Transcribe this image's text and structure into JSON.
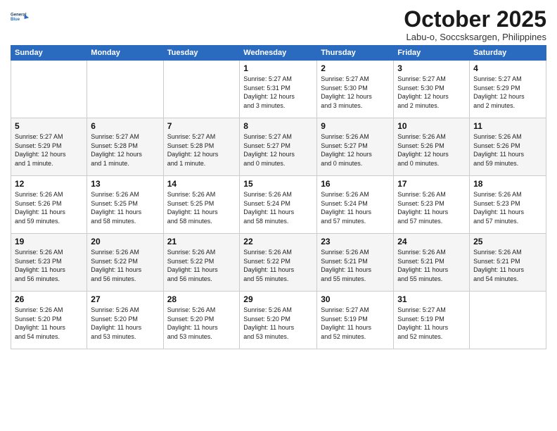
{
  "logo": {
    "line1": "General",
    "line2": "Blue"
  },
  "title": "October 2025",
  "subtitle": "Labu-o, Soccsksargen, Philippines",
  "days_header": [
    "Sunday",
    "Monday",
    "Tuesday",
    "Wednesday",
    "Thursday",
    "Friday",
    "Saturday"
  ],
  "weeks": [
    [
      {
        "day": "",
        "info": ""
      },
      {
        "day": "",
        "info": ""
      },
      {
        "day": "",
        "info": ""
      },
      {
        "day": "1",
        "info": "Sunrise: 5:27 AM\nSunset: 5:31 PM\nDaylight: 12 hours\nand 3 minutes."
      },
      {
        "day": "2",
        "info": "Sunrise: 5:27 AM\nSunset: 5:30 PM\nDaylight: 12 hours\nand 3 minutes."
      },
      {
        "day": "3",
        "info": "Sunrise: 5:27 AM\nSunset: 5:30 PM\nDaylight: 12 hours\nand 2 minutes."
      },
      {
        "day": "4",
        "info": "Sunrise: 5:27 AM\nSunset: 5:29 PM\nDaylight: 12 hours\nand 2 minutes."
      }
    ],
    [
      {
        "day": "5",
        "info": "Sunrise: 5:27 AM\nSunset: 5:29 PM\nDaylight: 12 hours\nand 1 minute."
      },
      {
        "day": "6",
        "info": "Sunrise: 5:27 AM\nSunset: 5:28 PM\nDaylight: 12 hours\nand 1 minute."
      },
      {
        "day": "7",
        "info": "Sunrise: 5:27 AM\nSunset: 5:28 PM\nDaylight: 12 hours\nand 1 minute."
      },
      {
        "day": "8",
        "info": "Sunrise: 5:27 AM\nSunset: 5:27 PM\nDaylight: 12 hours\nand 0 minutes."
      },
      {
        "day": "9",
        "info": "Sunrise: 5:26 AM\nSunset: 5:27 PM\nDaylight: 12 hours\nand 0 minutes."
      },
      {
        "day": "10",
        "info": "Sunrise: 5:26 AM\nSunset: 5:26 PM\nDaylight: 12 hours\nand 0 minutes."
      },
      {
        "day": "11",
        "info": "Sunrise: 5:26 AM\nSunset: 5:26 PM\nDaylight: 11 hours\nand 59 minutes."
      }
    ],
    [
      {
        "day": "12",
        "info": "Sunrise: 5:26 AM\nSunset: 5:26 PM\nDaylight: 11 hours\nand 59 minutes."
      },
      {
        "day": "13",
        "info": "Sunrise: 5:26 AM\nSunset: 5:25 PM\nDaylight: 11 hours\nand 58 minutes."
      },
      {
        "day": "14",
        "info": "Sunrise: 5:26 AM\nSunset: 5:25 PM\nDaylight: 11 hours\nand 58 minutes."
      },
      {
        "day": "15",
        "info": "Sunrise: 5:26 AM\nSunset: 5:24 PM\nDaylight: 11 hours\nand 58 minutes."
      },
      {
        "day": "16",
        "info": "Sunrise: 5:26 AM\nSunset: 5:24 PM\nDaylight: 11 hours\nand 57 minutes."
      },
      {
        "day": "17",
        "info": "Sunrise: 5:26 AM\nSunset: 5:23 PM\nDaylight: 11 hours\nand 57 minutes."
      },
      {
        "day": "18",
        "info": "Sunrise: 5:26 AM\nSunset: 5:23 PM\nDaylight: 11 hours\nand 57 minutes."
      }
    ],
    [
      {
        "day": "19",
        "info": "Sunrise: 5:26 AM\nSunset: 5:23 PM\nDaylight: 11 hours\nand 56 minutes."
      },
      {
        "day": "20",
        "info": "Sunrise: 5:26 AM\nSunset: 5:22 PM\nDaylight: 11 hours\nand 56 minutes."
      },
      {
        "day": "21",
        "info": "Sunrise: 5:26 AM\nSunset: 5:22 PM\nDaylight: 11 hours\nand 56 minutes."
      },
      {
        "day": "22",
        "info": "Sunrise: 5:26 AM\nSunset: 5:22 PM\nDaylight: 11 hours\nand 55 minutes."
      },
      {
        "day": "23",
        "info": "Sunrise: 5:26 AM\nSunset: 5:21 PM\nDaylight: 11 hours\nand 55 minutes."
      },
      {
        "day": "24",
        "info": "Sunrise: 5:26 AM\nSunset: 5:21 PM\nDaylight: 11 hours\nand 55 minutes."
      },
      {
        "day": "25",
        "info": "Sunrise: 5:26 AM\nSunset: 5:21 PM\nDaylight: 11 hours\nand 54 minutes."
      }
    ],
    [
      {
        "day": "26",
        "info": "Sunrise: 5:26 AM\nSunset: 5:20 PM\nDaylight: 11 hours\nand 54 minutes."
      },
      {
        "day": "27",
        "info": "Sunrise: 5:26 AM\nSunset: 5:20 PM\nDaylight: 11 hours\nand 53 minutes."
      },
      {
        "day": "28",
        "info": "Sunrise: 5:26 AM\nSunset: 5:20 PM\nDaylight: 11 hours\nand 53 minutes."
      },
      {
        "day": "29",
        "info": "Sunrise: 5:26 AM\nSunset: 5:20 PM\nDaylight: 11 hours\nand 53 minutes."
      },
      {
        "day": "30",
        "info": "Sunrise: 5:27 AM\nSunset: 5:19 PM\nDaylight: 11 hours\nand 52 minutes."
      },
      {
        "day": "31",
        "info": "Sunrise: 5:27 AM\nSunset: 5:19 PM\nDaylight: 11 hours\nand 52 minutes."
      },
      {
        "day": "",
        "info": ""
      }
    ]
  ]
}
